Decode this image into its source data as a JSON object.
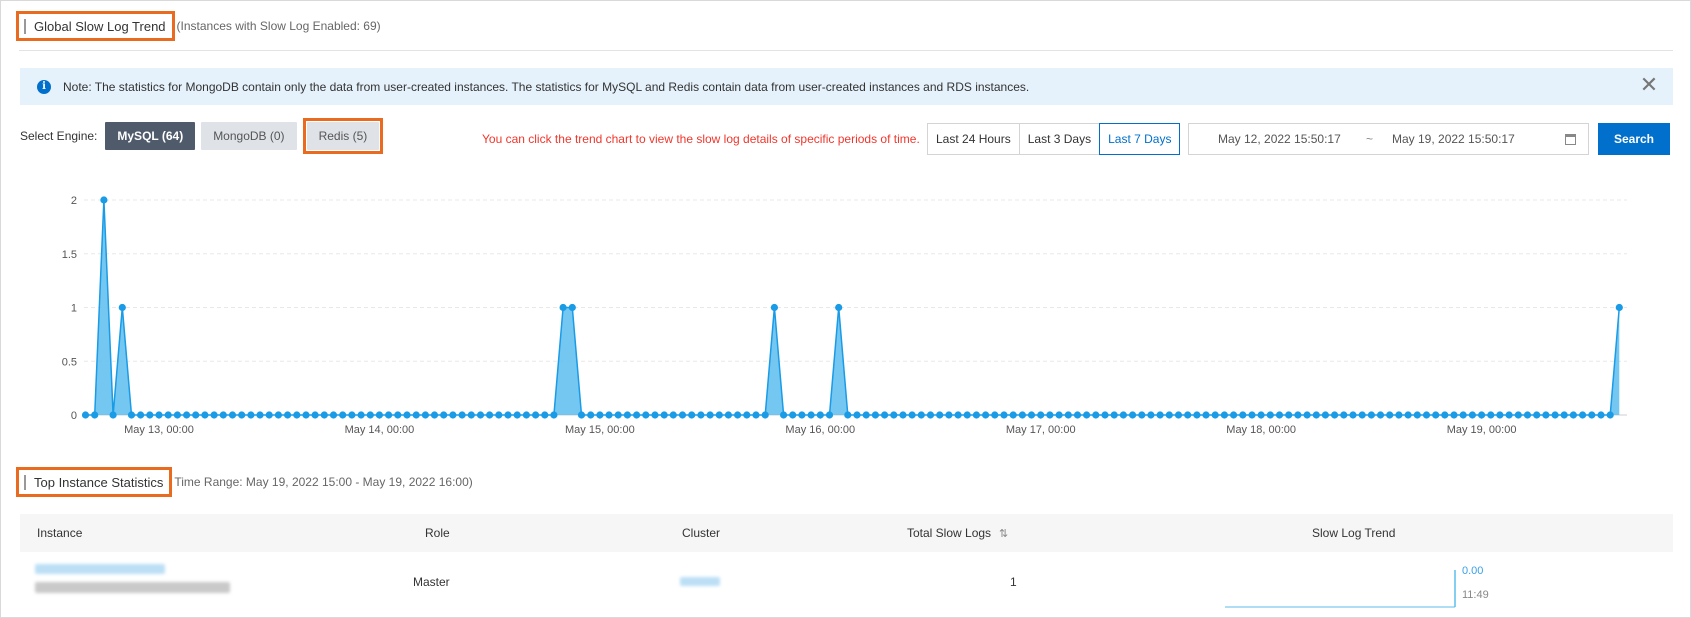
{
  "global": {
    "title": "Global Slow Log Trend",
    "subtitle": "(Instances with Slow Log Enabled: 69)"
  },
  "notice": {
    "text": "Note: The statistics for MongoDB contain only the data from user-created instances. The statistics for MySQL and Redis contain data from user-created instances and RDS instances."
  },
  "engine": {
    "label": "Select Engine:",
    "options": [
      {
        "label": "MySQL (64)",
        "selected": true
      },
      {
        "label": "MongoDB (0)",
        "selected": false
      },
      {
        "label": "Redis (5)",
        "selected": false
      }
    ]
  },
  "hint": "You can click the trend chart to view the slow log details of specific periods of time.",
  "range": {
    "options": [
      "Last 24 Hours",
      "Last 3 Days",
      "Last 7 Days"
    ],
    "selected": "Last 7 Days",
    "start": "May 12, 2022 15:50:17",
    "separator": "~",
    "end": "May 19, 2022 15:50:17"
  },
  "search_label": "Search",
  "chart_data": {
    "type": "area",
    "y_ticks": [
      "0",
      "0.5",
      "1",
      "1.5",
      "2"
    ],
    "ylim": [
      0,
      2
    ],
    "x_tick_labels": [
      "May 13, 00:00",
      "May 14, 00:00",
      "May 15, 00:00",
      "May 16, 00:00",
      "May 17, 00:00",
      "May 18, 00:00",
      "May 19, 00:00"
    ],
    "xlim": [
      "May 12, 2022 15:50",
      "May 19, 2022 15:50"
    ],
    "grid": true,
    "color": "#1a9be6",
    "fill": "#5bbdee",
    "baseline_value": 0,
    "points": [
      {
        "x": "May 12, 2022 18:00",
        "y": 2
      },
      {
        "x": "May 12, 2022 19:00",
        "y": 0
      },
      {
        "x": "May 12, 2022 20:00",
        "y": 1
      },
      {
        "x": "May 14, 2022 20:00",
        "y": 1
      },
      {
        "x": "May 14, 2022 21:00",
        "y": 1
      },
      {
        "x": "May 15, 2022 19:00",
        "y": 1
      },
      {
        "x": "May 16, 2022 00:00",
        "y": 0
      },
      {
        "x": "May 16, 2022 02:00",
        "y": 1
      },
      {
        "x": "May 19, 2022 15:00",
        "y": 1
      }
    ]
  },
  "top": {
    "title": "Top Instance Statistics",
    "subtitle": "Time Range: May 19, 2022 15:00 - May 19, 2022 16:00)",
    "columns": [
      "Instance",
      "Role",
      "Cluster",
      "Total Slow Logs",
      "Slow Log Trend"
    ],
    "rows": [
      {
        "role": "Master",
        "total": "1",
        "trend_value": "0.00",
        "trend_time": "11:49"
      }
    ]
  },
  "colors": {
    "accent": "#0070cc",
    "highlight": "#e96b1f",
    "hint": "#f0362c",
    "notice_bg": "#e6f2fb"
  }
}
